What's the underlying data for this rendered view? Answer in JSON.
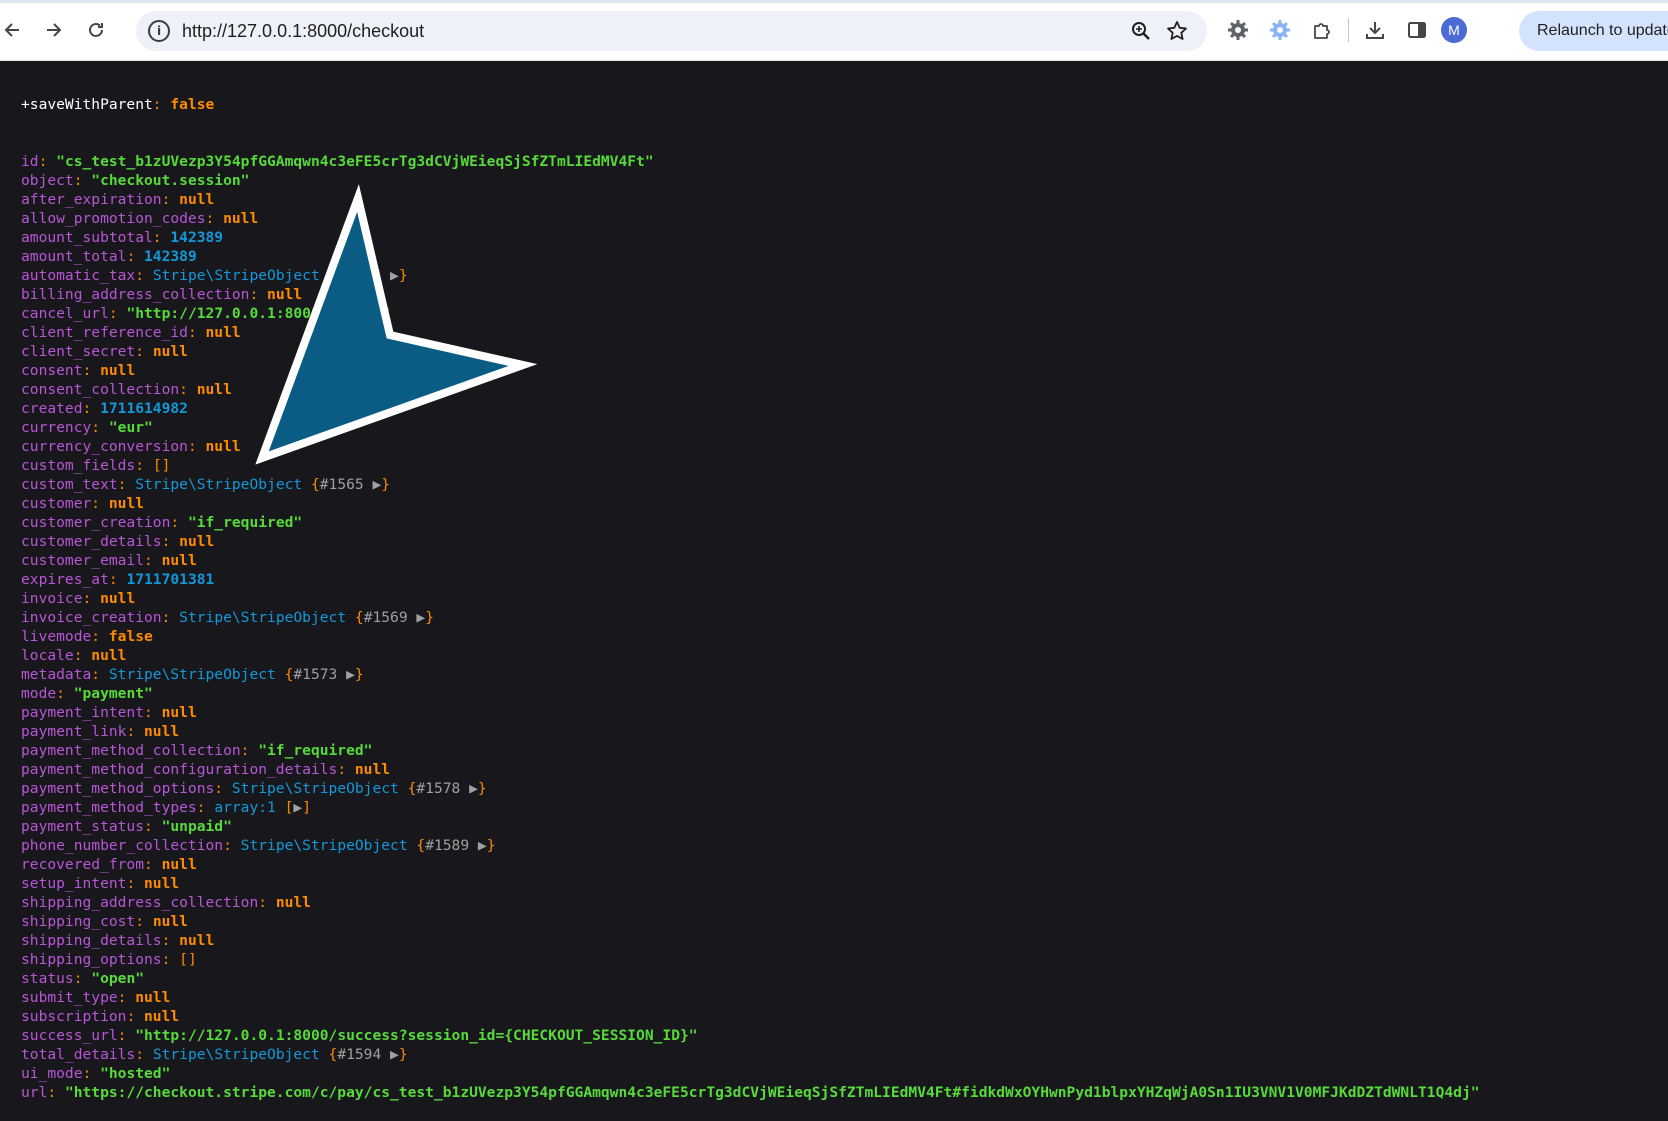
{
  "browser": {
    "url": "http://127.0.0.1:8000/checkout",
    "relaunch_label": "Relaunch to update",
    "profile_initial": "M",
    "icons": [
      "back-icon",
      "forward-icon",
      "reload-icon",
      "site-info-icon",
      "zoom-icon",
      "bookmark-star-icon",
      "extension-gear-icon",
      "extension-flower-icon",
      "extensions-puzzle-icon",
      "download-icon",
      "side-panel-icon"
    ]
  },
  "dump": {
    "first_key": "+saveWithParent",
    "first_value": "false",
    "rows": [
      {
        "key": "id",
        "type": "s",
        "value": "\"cs_test_b1zUVezp3Y54pfGGAmqwn4c3eFE5crTg3dCVjWEieqSjSfZTmLIEdMV4Ft\""
      },
      {
        "key": "object",
        "type": "s",
        "value": "\"checkout.session\""
      },
      {
        "key": "after_expiration",
        "type": "c",
        "value": "null"
      },
      {
        "key": "allow_promotion_codes",
        "type": "c",
        "value": "null"
      },
      {
        "key": "amount_subtotal",
        "type": "n",
        "value": "142389"
      },
      {
        "key": "amount_total",
        "type": "n",
        "value": "142389"
      },
      {
        "key": "automatic_tax",
        "type": "obj",
        "value": "Stripe\\StripeObject",
        "ref": "#1564"
      },
      {
        "key": "billing_address_collection",
        "type": "c",
        "value": "null"
      },
      {
        "key": "cancel_url",
        "type": "s",
        "value": "\"http://127.0.0.1:8000/cancel\""
      },
      {
        "key": "client_reference_id",
        "type": "c",
        "value": "null"
      },
      {
        "key": "client_secret",
        "type": "c",
        "value": "null"
      },
      {
        "key": "consent",
        "type": "c",
        "value": "null"
      },
      {
        "key": "consent_collection",
        "type": "c",
        "value": "null"
      },
      {
        "key": "created",
        "type": "n",
        "value": "1711614982"
      },
      {
        "key": "currency",
        "type": "s",
        "value": "\"eur\""
      },
      {
        "key": "currency_conversion",
        "type": "c",
        "value": "null"
      },
      {
        "key": "custom_fields",
        "type": "arr",
        "value": "[]"
      },
      {
        "key": "custom_text",
        "type": "obj",
        "value": "Stripe\\StripeObject",
        "ref": "#1565"
      },
      {
        "key": "customer",
        "type": "c",
        "value": "null"
      },
      {
        "key": "customer_creation",
        "type": "s",
        "value": "\"if_required\""
      },
      {
        "key": "customer_details",
        "type": "c",
        "value": "null"
      },
      {
        "key": "customer_email",
        "type": "c",
        "value": "null"
      },
      {
        "key": "expires_at",
        "type": "n",
        "value": "1711701381"
      },
      {
        "key": "invoice",
        "type": "c",
        "value": "null"
      },
      {
        "key": "invoice_creation",
        "type": "obj",
        "value": "Stripe\\StripeObject",
        "ref": "#1569"
      },
      {
        "key": "livemode",
        "type": "c",
        "value": "false"
      },
      {
        "key": "locale",
        "type": "c",
        "value": "null"
      },
      {
        "key": "metadata",
        "type": "obj",
        "value": "Stripe\\StripeObject",
        "ref": "#1573"
      },
      {
        "key": "mode",
        "type": "s",
        "value": "\"payment\""
      },
      {
        "key": "payment_intent",
        "type": "c",
        "value": "null"
      },
      {
        "key": "payment_link",
        "type": "c",
        "value": "null"
      },
      {
        "key": "payment_method_collection",
        "type": "s",
        "value": "\"if_required\""
      },
      {
        "key": "payment_method_configuration_details",
        "type": "c",
        "value": "null"
      },
      {
        "key": "payment_method_options",
        "type": "obj",
        "value": "Stripe\\StripeObject",
        "ref": "#1578"
      },
      {
        "key": "payment_method_types",
        "type": "array",
        "value": "array:1"
      },
      {
        "key": "payment_status",
        "type": "s",
        "value": "\"unpaid\""
      },
      {
        "key": "phone_number_collection",
        "type": "obj",
        "value": "Stripe\\StripeObject",
        "ref": "#1589"
      },
      {
        "key": "recovered_from",
        "type": "c",
        "value": "null"
      },
      {
        "key": "setup_intent",
        "type": "c",
        "value": "null"
      },
      {
        "key": "shipping_address_collection",
        "type": "c",
        "value": "null"
      },
      {
        "key": "shipping_cost",
        "type": "c",
        "value": "null"
      },
      {
        "key": "shipping_details",
        "type": "c",
        "value": "null"
      },
      {
        "key": "shipping_options",
        "type": "arr",
        "value": "[]"
      },
      {
        "key": "status",
        "type": "s",
        "value": "\"open\""
      },
      {
        "key": "submit_type",
        "type": "c",
        "value": "null"
      },
      {
        "key": "subscription",
        "type": "c",
        "value": "null"
      },
      {
        "key": "success_url",
        "type": "s",
        "value": "\"http://127.0.0.1:8000/success?session_id={CHECKOUT_SESSION_ID}\""
      },
      {
        "key": "total_details",
        "type": "obj",
        "value": "Stripe\\StripeObject",
        "ref": "#1594"
      },
      {
        "key": "ui_mode",
        "type": "s",
        "value": "\"hosted\""
      },
      {
        "key": "url",
        "type": "s",
        "value": "\"https://checkout.stripe.com/c/pay/cs_test_b1zUVezp3Y54pfGGAmqwn4c3eFE5crTg3dCVjWEieqSjSfZTmLIEdMV4Ft#fidkdWxOYHwnPyd1blpxYHZqWjA0Sn1IU3VNV1V0MFJKdDZTdWNLT1Q4dj\""
      }
    ]
  },
  "theme": {
    "background": "#18171b",
    "key_color": "#b856d6",
    "string_color": "#56db3a",
    "number_color": "#1299da",
    "const_color": "#ff8c00",
    "cursor_fill": "#0b5c84"
  }
}
